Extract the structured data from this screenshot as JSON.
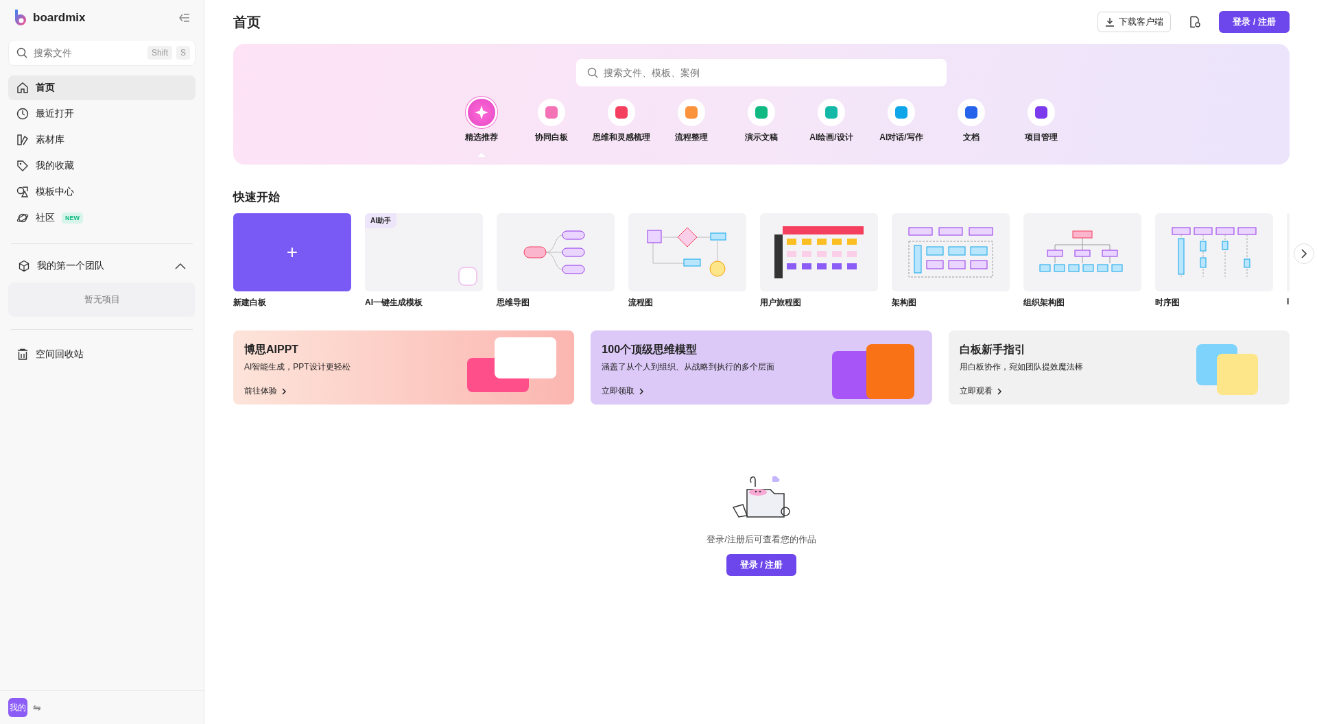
{
  "sidebar": {
    "logo": "boardmix",
    "search": {
      "placeholder": "搜索文件",
      "keys": [
        "Shift",
        "S"
      ]
    },
    "items": [
      {
        "label": "首页",
        "selected": true
      },
      {
        "label": "最近打开",
        "selected": false
      },
      {
        "label": "素材库",
        "selected": false
      },
      {
        "label": "我的收藏",
        "selected": false
      },
      {
        "label": "模板中心",
        "selected": false
      },
      {
        "label": "社区",
        "selected": false,
        "badge": "NEW"
      }
    ],
    "team": {
      "name": "我的第一个团队",
      "expanded": true,
      "empty": "暂无项目"
    },
    "trash": "空间回收站",
    "user": {
      "avatar": "我的",
      "switch": "⇋"
    }
  },
  "header": {
    "title": "首页",
    "download": "下载客户端",
    "login": "登录 / 注册"
  },
  "hero": {
    "search": {
      "placeholder": "搜索文件、模板、案例"
    },
    "categories": [
      {
        "label": "精选推荐",
        "selected": true
      },
      {
        "label": "协同白板",
        "selected": false
      },
      {
        "label": "思维和灵感梳理",
        "selected": false
      },
      {
        "label": "流程整理",
        "selected": false
      },
      {
        "label": "演示文稿",
        "selected": false
      },
      {
        "label": "AI绘画/设计",
        "selected": false
      },
      {
        "label": "AI对话/写作",
        "selected": false
      },
      {
        "label": "文档",
        "selected": false
      },
      {
        "label": "项目管理",
        "selected": false
      }
    ]
  },
  "quick_start": {
    "title": "快速开始",
    "cards": [
      {
        "label": "新建白板",
        "kind": "new",
        "icon_text": "+"
      },
      {
        "label": "AI一键生成模板",
        "kind": "ai",
        "badge": "AI助手"
      },
      {
        "label": "思维导图",
        "kind": "mindmap"
      },
      {
        "label": "流程图",
        "kind": "flowchart"
      },
      {
        "label": "用户旅程图",
        "kind": "journey"
      },
      {
        "label": "架构图",
        "kind": "architecture"
      },
      {
        "label": "组织架构图",
        "kind": "org"
      },
      {
        "label": "时序图",
        "kind": "sequence"
      },
      {
        "label": "I",
        "kind": "partial"
      }
    ]
  },
  "banners": [
    {
      "title": "博思AIPPT",
      "desc": "AI智能生成，PPT设计更轻松",
      "link": "前往体验"
    },
    {
      "title": "100个顶级思维模型",
      "desc": "涵盖了从个人到组织、从战略到执行的多个层面",
      "link": "立即领取"
    },
    {
      "title": "白板新手指引",
      "desc": "用白板协作，宛如团队提效魔法棒",
      "link": "立即观看"
    }
  ],
  "empty_state": {
    "message": "登录/注册后可查看您的作品",
    "button": "登录 / 注册"
  }
}
